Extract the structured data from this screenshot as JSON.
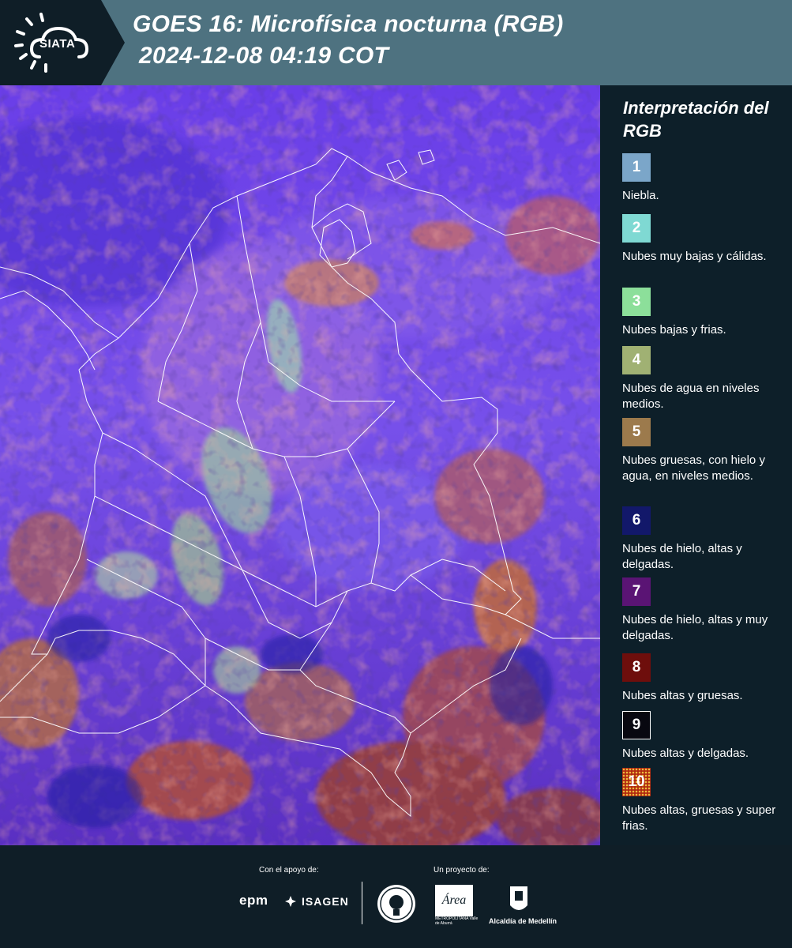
{
  "header": {
    "logo_text": "SIATA",
    "title_line1": "GOES 16: Microfísica nocturna (RGB)",
    "title_line2": "2024-12-08 04:19 COT",
    "background": "#4e7280",
    "logo_background": "#0f1e27"
  },
  "map": {
    "icon": "satellite-rgb-image",
    "base_color": "#5a36d6",
    "border_color": "#ffffff"
  },
  "legend": {
    "title": "Interpretación del RGB",
    "items": [
      {
        "number": "1",
        "color": "#7ba6c9",
        "label": "Niebla."
      },
      {
        "number": "2",
        "color": "#7fd9d3",
        "label": "Nubes muy bajas y cálidas."
      },
      {
        "number": "3",
        "color": "#8cdf9a",
        "label": "Nubes bajas y frias."
      },
      {
        "number": "4",
        "color": "#a0b173",
        "label": "Nubes de agua en niveles medios."
      },
      {
        "number": "5",
        "color": "#9c7a4c",
        "label": "Nubes gruesas, con hielo y agua, en niveles medios."
      },
      {
        "number": "6",
        "color": "#12186a",
        "label": "Nubes de hielo, altas y delgadas."
      },
      {
        "number": "7",
        "color": "#5a1474",
        "label": "Nubes de hielo, altas y muy delgadas."
      },
      {
        "number": "8",
        "color": "#6e0e0c",
        "label": "Nubes altas y gruesas."
      },
      {
        "number": "9",
        "color": "#080810",
        "label": "Nubes altas y delgadas."
      },
      {
        "number": "10",
        "color": "#b02a10",
        "label": "Nubes altas, gruesas y super frias."
      }
    ]
  },
  "footer": {
    "support_label": "Con el apoyo de:",
    "project_label": "Un proyecto de:",
    "epm_text": "epm",
    "isagen_text": "ISAGEN",
    "area_text": "Área",
    "area_sub": "METROPOLITANA Valle de Aburrá",
    "alcaldia_text": "Alcaldía de Medellín"
  }
}
